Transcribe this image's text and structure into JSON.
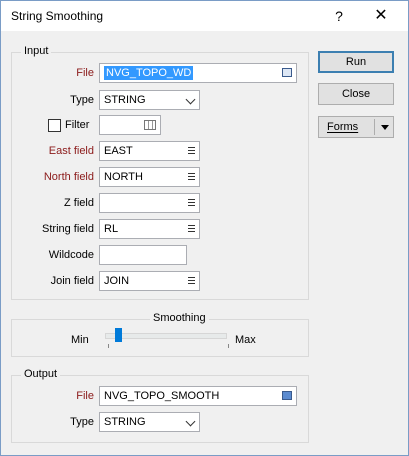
{
  "window": {
    "title": "String Smoothing",
    "help_glyph": "?",
    "close_glyph": "✕"
  },
  "input": {
    "group_title": "Input",
    "file_label": "File",
    "file_value": "NVG_TOPO_WD",
    "type_label": "Type",
    "type_value": "STRING",
    "filter_label": "Filter",
    "filter_checked": false,
    "east_label": "East field",
    "east_value": "EAST",
    "north_label": "North field",
    "north_value": "NORTH",
    "z_label": "Z field",
    "z_value": "",
    "string_label": "String field",
    "string_value": "RL",
    "wildcode_label": "Wildcode",
    "wildcode_value": "",
    "join_label": "Join field",
    "join_value": "JOIN"
  },
  "smoothing": {
    "group_title": "Smoothing",
    "min_label": "Min",
    "max_label": "Max",
    "level": 0.08
  },
  "output": {
    "group_title": "Output",
    "file_label": "File",
    "file_value": "NVG_TOPO_SMOOTH",
    "type_label": "Type",
    "type_value": "STRING"
  },
  "buttons": {
    "run": "Run",
    "close": "Close",
    "forms": "Forms"
  },
  "colors": {
    "required_label": "#8b1a1a",
    "selection": "#3399ff",
    "slider_thumb": "#007ad9"
  }
}
